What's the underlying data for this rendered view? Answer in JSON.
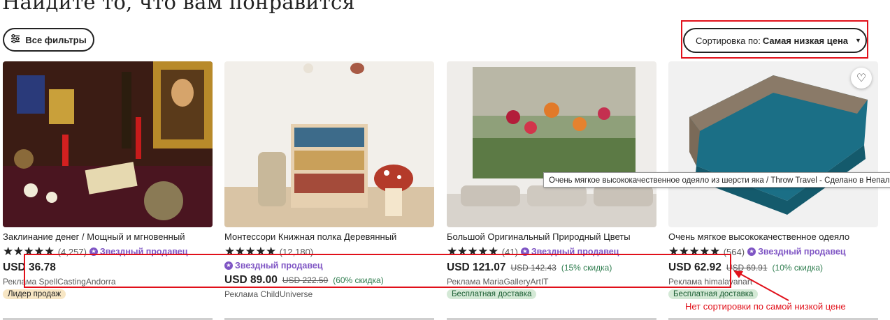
{
  "page": {
    "heading": "Найдите то, что вам понравится",
    "filters_label": "Все фильтры",
    "sort_prefix": "Сортировка по:",
    "sort_value": "Самая низкая цена",
    "tooltip": "Очень мягкое высококачественное одеяло из шерсти яка / Throw Travel - Сделано в Непале",
    "annotation": "Нет сортировки по самой низкой цене"
  },
  "colors": {
    "accent_red": "#e1101a",
    "star_seller": "#7f55c4",
    "discount_green": "#2f7d4f"
  },
  "products": [
    {
      "name": "Заклинание денег / Мощный и мгновенный",
      "stars": "★★★★★",
      "count": "(4,257)",
      "star_seller": "Звездный продавец",
      "price": "USD 36.78",
      "old_price": "",
      "discount": "",
      "ad": "Реклама SpellCastingAndorra",
      "badge": "Лидер продаж"
    },
    {
      "name": "Монтессори Книжная полка Деревянный",
      "stars": "★★★★★",
      "count": "(12,180)",
      "star_seller": "Звездный продавец",
      "price": "USD 89.00",
      "old_price": "USD 222.50",
      "discount": "(60% скидка)",
      "ad": "Реклама ChildUniverse",
      "badge": ""
    },
    {
      "name": "Большой Оригинальный Природный Цветы",
      "stars": "★★★★★",
      "count": "(41)",
      "star_seller": "Звездный продавец",
      "price": "USD 121.07",
      "old_price": "USD 142.43",
      "discount": "(15% скидка)",
      "ad": "Реклама MariaGalleryArtIT",
      "badge": "Бесплатная доставка"
    },
    {
      "name": "Очень мягкое высококачественное одеяло",
      "stars": "★★★★★",
      "count": "(564)",
      "star_seller": "Звездный продавец",
      "price": "USD 62.92",
      "old_price": "USD 69.91",
      "discount": "(10% скидка)",
      "ad": "Реклама himalayanart",
      "badge": "Бесплатная доставка"
    }
  ]
}
